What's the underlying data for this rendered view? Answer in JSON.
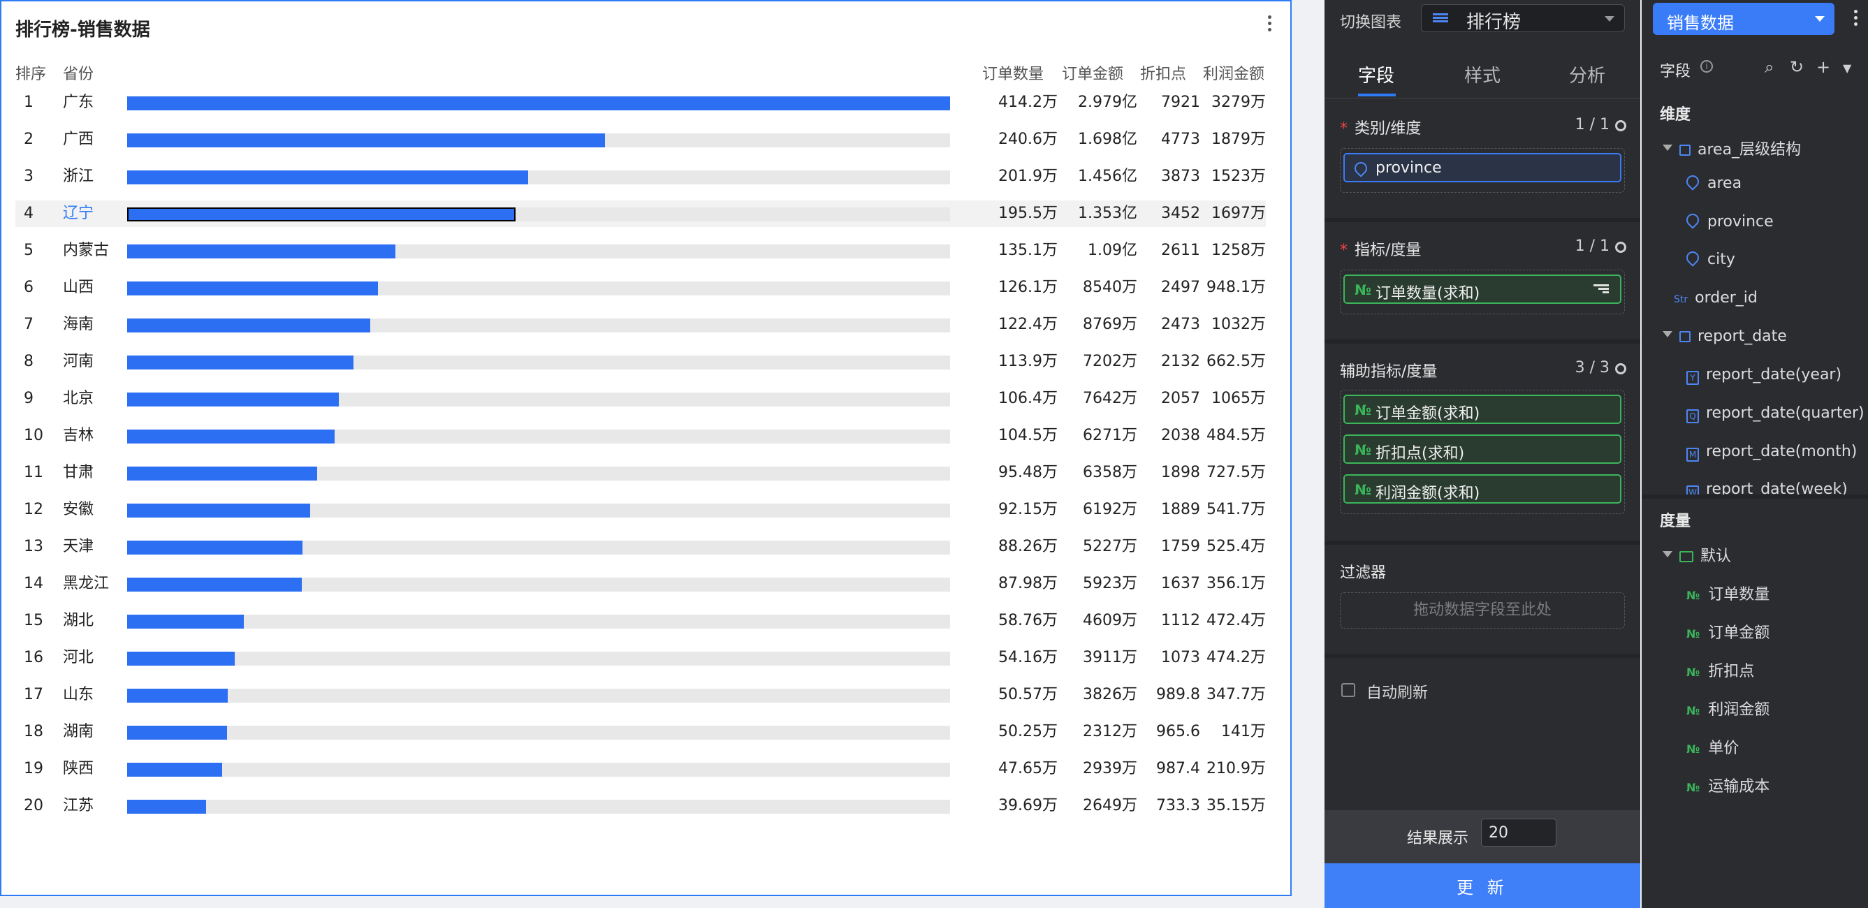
{
  "chart": {
    "title": "排行榜-销售数据",
    "headers": {
      "rank": "排序",
      "province": "省份",
      "orders": "订单数量",
      "amount": "订单金额",
      "discount": "折扣点",
      "profit": "利润金额"
    },
    "rows": [
      {
        "rank": "1",
        "province": "广东",
        "orders": "414.2万",
        "amount": "2.979亿",
        "discount": "7921",
        "profit": "3279万"
      },
      {
        "rank": "2",
        "province": "广西",
        "orders": "240.6万",
        "amount": "1.698亿",
        "discount": "4773",
        "profit": "1879万"
      },
      {
        "rank": "3",
        "province": "浙江",
        "orders": "201.9万",
        "amount": "1.456亿",
        "discount": "3873",
        "profit": "1523万"
      },
      {
        "rank": "4",
        "province": "辽宁",
        "orders": "195.5万",
        "amount": "1.353亿",
        "discount": "3452",
        "profit": "1697万"
      },
      {
        "rank": "5",
        "province": "内蒙古",
        "orders": "135.1万",
        "amount": "1.09亿",
        "discount": "2611",
        "profit": "1258万"
      },
      {
        "rank": "6",
        "province": "山西",
        "orders": "126.1万",
        "amount": "8540万",
        "discount": "2497",
        "profit": "948.1万"
      },
      {
        "rank": "7",
        "province": "海南",
        "orders": "122.4万",
        "amount": "8769万",
        "discount": "2473",
        "profit": "1032万"
      },
      {
        "rank": "8",
        "province": "河南",
        "orders": "113.9万",
        "amount": "7202万",
        "discount": "2132",
        "profit": "662.5万"
      },
      {
        "rank": "9",
        "province": "北京",
        "orders": "106.4万",
        "amount": "7642万",
        "discount": "2057",
        "profit": "1065万"
      },
      {
        "rank": "10",
        "province": "吉林",
        "orders": "104.5万",
        "amount": "6271万",
        "discount": "2038",
        "profit": "484.5万"
      },
      {
        "rank": "11",
        "province": "甘肃",
        "orders": "95.48万",
        "amount": "6358万",
        "discount": "1898",
        "profit": "727.5万"
      },
      {
        "rank": "12",
        "province": "安徽",
        "orders": "92.15万",
        "amount": "6192万",
        "discount": "1889",
        "profit": "541.7万"
      },
      {
        "rank": "13",
        "province": "天津",
        "orders": "88.26万",
        "amount": "5227万",
        "discount": "1759",
        "profit": "525.4万"
      },
      {
        "rank": "14",
        "province": "黑龙江",
        "orders": "87.98万",
        "amount": "5923万",
        "discount": "1637",
        "profit": "356.1万"
      },
      {
        "rank": "15",
        "province": "湖北",
        "orders": "58.76万",
        "amount": "4609万",
        "discount": "1112",
        "profit": "472.4万"
      },
      {
        "rank": "16",
        "province": "河北",
        "orders": "54.16万",
        "amount": "3911万",
        "discount": "1073",
        "profit": "474.2万"
      },
      {
        "rank": "17",
        "province": "山东",
        "orders": "50.57万",
        "amount": "3826万",
        "discount": "989.8",
        "profit": "347.7万"
      },
      {
        "rank": "18",
        "province": "湖南",
        "orders": "50.25万",
        "amount": "2312万",
        "discount": "965.6",
        "profit": "141万"
      },
      {
        "rank": "19",
        "province": "陕西",
        "orders": "47.65万",
        "amount": "2939万",
        "discount": "987.4",
        "profit": "210.9万"
      },
      {
        "rank": "20",
        "province": "江苏",
        "orders": "39.69万",
        "amount": "2649万",
        "discount": "733.3",
        "profit": "35.15万"
      }
    ],
    "bar_values": [
      414.2,
      240.6,
      201.9,
      195.5,
      135.1,
      126.1,
      122.4,
      113.9,
      106.4,
      104.5,
      95.48,
      92.15,
      88.26,
      87.98,
      58.76,
      54.16,
      50.57,
      50.25,
      47.65,
      39.69
    ],
    "bar_max": 414.2,
    "highlighted_row": 3,
    "bar_color": "#2d6ff2",
    "track_color": "#e8e8e8"
  },
  "config": {
    "switch_label": "切换图表",
    "chart_type": "排行榜",
    "chart_type_icon": "list-icon",
    "tabs": [
      "字段",
      "样式",
      "分析"
    ],
    "active_tab": 0,
    "dimension": {
      "title": "类别/维度",
      "count": "1 / 1",
      "fields": [
        "province"
      ]
    },
    "measure": {
      "title": "指标/度量",
      "count": "1 / 1",
      "fields": [
        "订单数量(求和)"
      ]
    },
    "aux": {
      "title": "辅助指标/度量",
      "count": "3 / 3",
      "fields": [
        "订单金额(求和)",
        "折扣点(求和)",
        "利润金额(求和)"
      ]
    },
    "filter": {
      "title": "过滤器",
      "placeholder": "拖动数据字段至此处"
    },
    "auto_refresh": "自动刷新",
    "result_label": "结果展示",
    "result_value": "20",
    "update_button": "更 新",
    "accent": "#3a7cf8",
    "measure_color": "#3bb55a"
  },
  "fields_panel": {
    "dataset": "销售数据",
    "title": "字段",
    "dimensions_label": "维度",
    "dimensions": {
      "hierarchy1": "area_层级结构",
      "hierarchy1_items": [
        "area",
        "province",
        "city"
      ],
      "order_id": "order_id",
      "hierarchy2": "report_date",
      "hierarchy2_items": [
        "report_date(year)",
        "report_date(quarter)",
        "report_date(month)",
        "report_date(week)"
      ],
      "date_tags": [
        "Y",
        "Q",
        "M",
        "W"
      ],
      "str_tag": "Str"
    },
    "measures_label": "度量",
    "measures_folder": "默认",
    "measures": [
      "订单数量",
      "订单金额",
      "折扣点",
      "利润金额",
      "单价",
      "运输成本"
    ],
    "num_tag": "№"
  }
}
